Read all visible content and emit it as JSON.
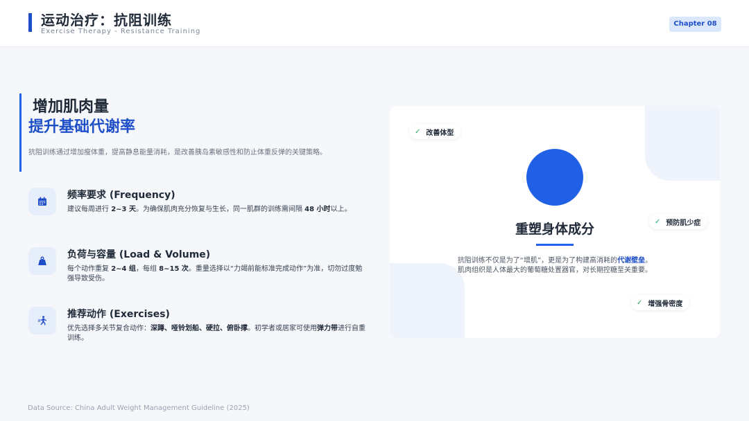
{
  "header": {
    "title": "运动治疗：抗阻训练",
    "subtitle": "Exercise Therapy - Resistance Training",
    "chapter": "Chapter 08"
  },
  "left": {
    "heading_line1": "增加肌肉量",
    "heading_line2": "提升基础代谢率",
    "intro": "抗阻训练通过增加瘦体重，提高静息能量消耗，是改善胰岛素敏感性和防止体重反弹的关键策略。",
    "features": [
      {
        "icon": "calendar-icon",
        "title": "频率要求 (Frequency)",
        "desc_parts": [
          "建议每周进行 ",
          "2~3 天",
          "。为确保肌肉充分恢复与生长，同一肌群的训练需间隔 ",
          "48 小时",
          "以上。"
        ]
      },
      {
        "icon": "weight-icon",
        "title": "负荷与容量 (Load & Volume)",
        "desc_parts": [
          "每个动作重复 ",
          "2~4 组",
          "，每组 ",
          "8~15 次",
          "。重量选择以“力竭前能标准完成动作”为准，切勿过度勉强导致受伤。"
        ]
      },
      {
        "icon": "running-icon",
        "title": "推荐动作 (Exercises)",
        "desc_parts": [
          "优先选择多关节复合动作：",
          "深蹲、哑铃划船、硬拉、俯卧撑",
          "。初学者或居家可使用",
          "弹力带",
          "进行自重训练。"
        ]
      }
    ]
  },
  "card": {
    "title": "重塑身体成分",
    "text_line1_prefix": "抗阻训练不仅是为了“增肌”，更是为了构建高消耗的",
    "text_line1_highlight": "代谢壁垒",
    "text_line1_suffix": "。",
    "text_line2": "肌肉组织是人体最大的葡萄糖处置器官，对长期控糖至关重要。",
    "tags": [
      "改善体型",
      "预防肌少症",
      "增强骨密度"
    ]
  },
  "footer": {
    "source": "Data Source: China Adult Weight Management Guideline (2025)"
  },
  "colors": {
    "accent": "#1e4fc8",
    "circle": "#2160e6",
    "check": "#22a861"
  }
}
